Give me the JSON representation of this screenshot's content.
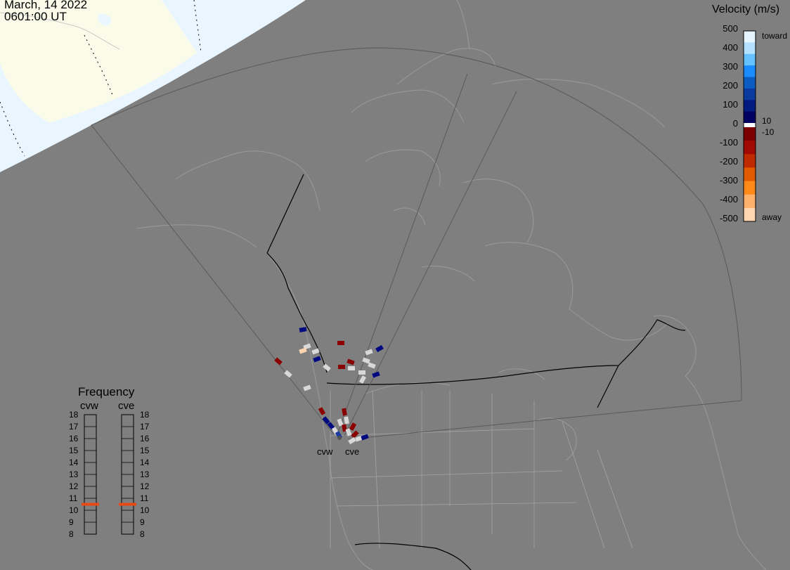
{
  "header": {
    "date": "March, 14 2022",
    "time": "0601:00 UT"
  },
  "velocity_legend": {
    "title": "Velocity (m/s)",
    "ticks": [
      "500",
      "400",
      "300",
      "200",
      "100",
      "0",
      "-100",
      "-200",
      "-300",
      "-400",
      "-500"
    ],
    "toward_label": "toward",
    "away_label": "away",
    "pos_threshold": "10",
    "neg_threshold": "-10",
    "colors": {
      "toward": [
        "#e6f5ff",
        "#b3e1ff",
        "#66c2ff",
        "#1a8cff",
        "#0a5cc2",
        "#0a3a9e",
        "#001a80",
        "#000060"
      ],
      "away": [
        "#7a0000",
        "#a00a00",
        "#c02a00",
        "#e05a00",
        "#ff8a1a",
        "#ffb06a",
        "#ffd6b0"
      ]
    }
  },
  "frequency_legend": {
    "title": "Frequency",
    "radars": [
      "cvw",
      "cve"
    ],
    "ticks": [
      "18",
      "17",
      "16",
      "15",
      "14",
      "13",
      "12",
      "11",
      "10",
      "9",
      "8"
    ],
    "active_mhz": {
      "cvw": 10.5,
      "cve": 10.5
    },
    "marker_color": "#e84a14"
  },
  "radar_sites": {
    "cvw_label": "cvw",
    "cve_label": "cve"
  },
  "map_colors": {
    "background": "#7f7f7f",
    "daylight_sky": "#eaf6ff",
    "daylight_land": "#fbfbe9",
    "coast": "#9a9a9a",
    "border": "#000000"
  }
}
